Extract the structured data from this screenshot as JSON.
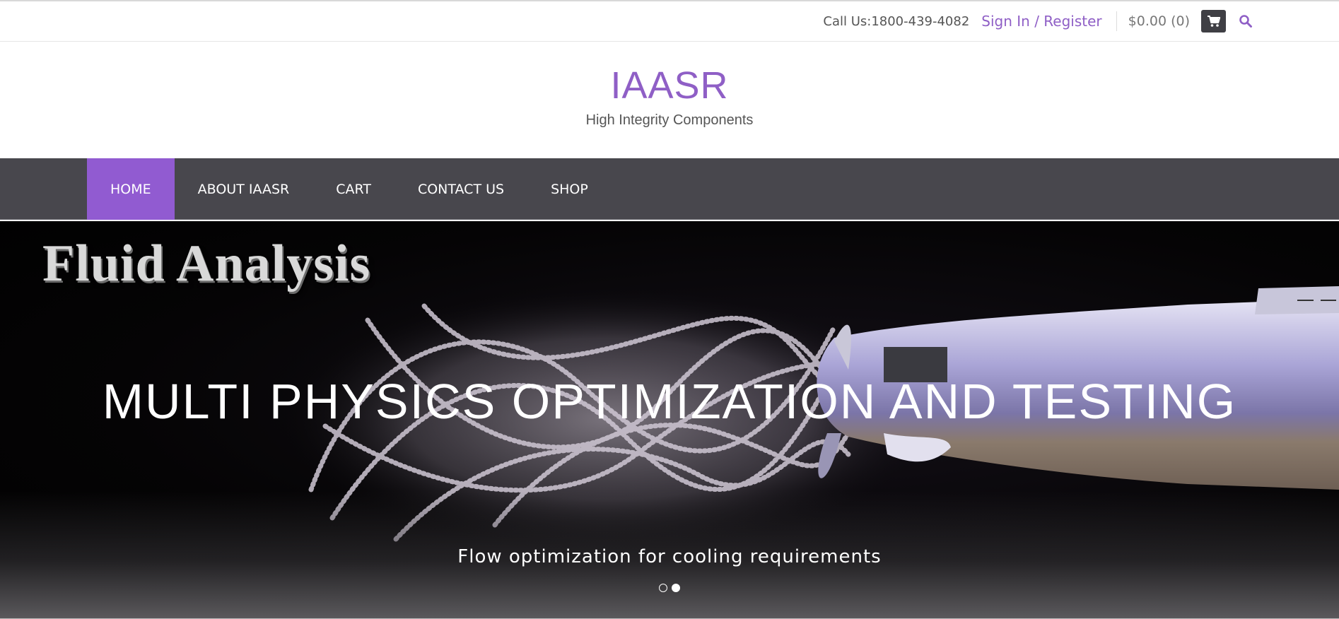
{
  "topbar": {
    "call": "Call Us:1800-439-4082",
    "signin": "Sign In / Register",
    "cart_total": "$0.00 (0)",
    "cart_icon": "shopping-cart-icon",
    "search_icon": "search-icon"
  },
  "brand": {
    "title": "IAASR",
    "subtitle": "High Integrity Components"
  },
  "nav": {
    "items": [
      "HOME",
      "ABOUT IAASR",
      "CART",
      "CONTACT US",
      "SHOP"
    ],
    "active": "HOME"
  },
  "hero": {
    "image_title": "Fluid Analysis",
    "heading": "MULTI PHYSICS OPTIMIZATION AND TESTING",
    "subheading": "Flow optimization for cooling requirements",
    "slides": 2,
    "active_slide": 2
  },
  "colors": {
    "accent": "#8f5fc6",
    "nav_bg": "#48474d",
    "nav_active": "#915bd1"
  }
}
